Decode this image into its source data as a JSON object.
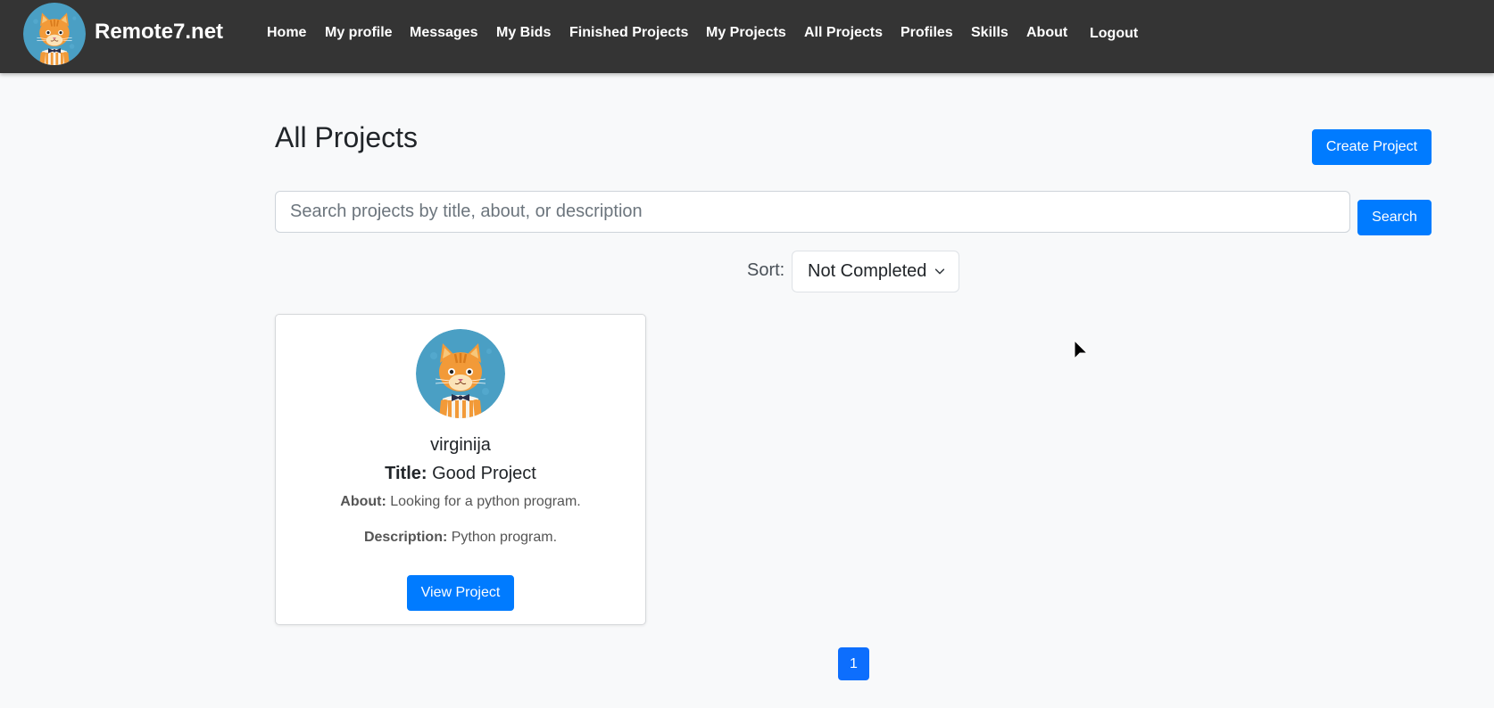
{
  "brand": {
    "name": "Remote7.net",
    "logo_icon": "cat-avatar-icon"
  },
  "nav": {
    "home": "Home",
    "my_profile": "My profile",
    "messages": "Messages",
    "my_bids": "My Bids",
    "finished_projects": "Finished Projects",
    "my_projects": "My Projects",
    "all_projects": "All Projects",
    "profiles": "Profiles",
    "skills": "Skills",
    "about": "About",
    "logout": "Logout"
  },
  "main": {
    "title": "All Projects",
    "create_button": "Create Project",
    "search": {
      "placeholder": "Search projects by title, about, or description",
      "value": "",
      "button": "Search"
    },
    "sort": {
      "label": "Sort:",
      "selected": "Not Completed"
    }
  },
  "projects": [
    {
      "username": "virginija",
      "title_label": "Title:",
      "title": "Good Project",
      "about_label": "About:",
      "about": "Looking for a python program.",
      "description_label": "Description:",
      "description": "Python program.",
      "button": "View Project"
    }
  ],
  "pagination": {
    "current_page": "1"
  },
  "colors": {
    "navbar": "#343434",
    "primary": "#007bff",
    "page_background": "#f8f9fa"
  }
}
